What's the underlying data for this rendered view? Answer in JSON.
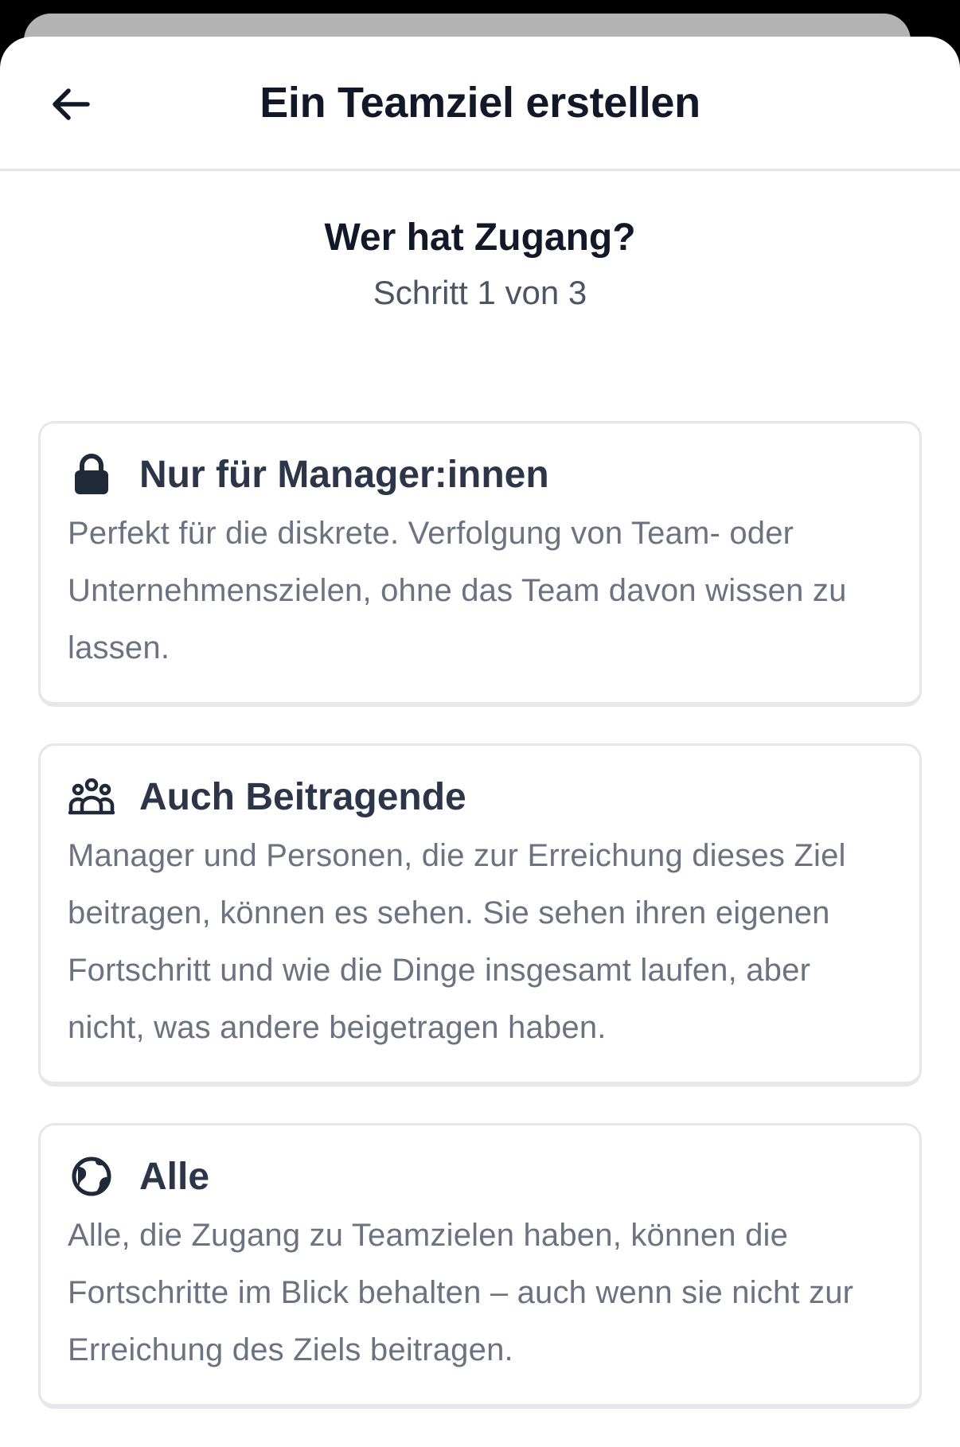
{
  "header": {
    "title": "Ein Teamziel erstellen",
    "back_icon": "arrow-left-icon"
  },
  "step": {
    "heading": "Wer hat Zugang?",
    "progress": "Schritt 1 von 3"
  },
  "options": [
    {
      "icon": "lock-icon",
      "title": "Nur für Manager:innen",
      "description": "Perfekt für die diskrete. Verfolgung von Team- oder Unternehmenszielen, ohne das Team davon wissen zu lassen."
    },
    {
      "icon": "people-group-icon",
      "title": "Auch Beitragende",
      "description": "Manager und Personen, die zur Erreichung dieses Ziel beitragen, können es sehen. Sie sehen ihren eigenen Fortschritt und wie die Dinge insgesamt laufen, aber nicht, was andere beigetragen haben."
    },
    {
      "icon": "globe-icon",
      "title": "Alle",
      "description": "Alle, die Zugang zu Teamzielen haben, können die Fortschritte im Blick behalten – auch wenn sie nicht zur Erreichung des Ziels beitragen."
    }
  ],
  "colors": {
    "title": "#111827",
    "card_title": "#2d3648",
    "card_text": "#6b7280",
    "border": "#e5e7eb"
  }
}
